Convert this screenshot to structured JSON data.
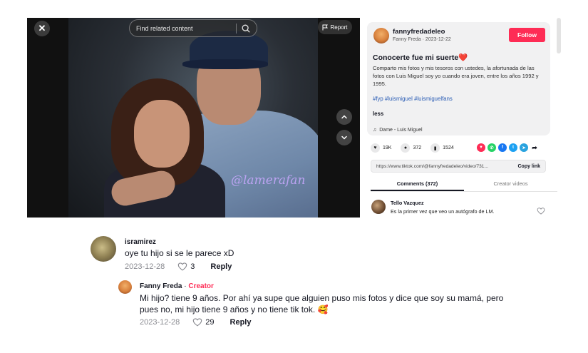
{
  "video": {
    "search_placeholder": "Find related content",
    "report_label": "Report",
    "watermark": "@lamerafan"
  },
  "post": {
    "username": "fannyfredadeleo",
    "display_name": "Fanny Freda",
    "date": "2023-12-22",
    "follow_label": "Follow",
    "title": "Conocerte fue mi suerte❤️",
    "description": "Comparto mis fotos y mis tesoros con ustedes, la afortunada de las fotos con Luis Miguel soy yo cuando era joven, entre los años 1992 y 1995.",
    "hashtags": "#fyp #luismiguel #luismiguelfans",
    "less_label": "less",
    "music": "Dame - Luis Miguel",
    "likes": "19K",
    "comments": "372",
    "saves": "1524",
    "link": "https://www.tiktok.com/@fannyfredadeleo/video/731...",
    "copy_link_label": "Copy link",
    "tab_comments": "Comments (372)",
    "tab_creator": "Creator videos",
    "preview_comment_user": "Tello Vazquez",
    "preview_comment_text": "Es la primer vez que veo un autógrafo de LM.",
    "colors": {
      "follow": "#fe2c55",
      "hashtag": "#2b5db5"
    }
  },
  "comments": [
    {
      "user": "isramirez",
      "text": "oye tu hijo si se le parece xD",
      "date": "2023-12-28",
      "likes": "3",
      "reply_label": "Reply"
    },
    {
      "user": "Fanny Freda",
      "separator": " · ",
      "badge": "Creator",
      "text": "Mi hijo? tiene 9 años. Por ahí ya supe que alguien puso mis fotos y dice que soy su mamá, pero pues no, mi hijo tiene 9 años y no tiene tik tok. 🥰",
      "date": "2023-12-28",
      "likes": "29",
      "reply_label": "Reply"
    }
  ]
}
